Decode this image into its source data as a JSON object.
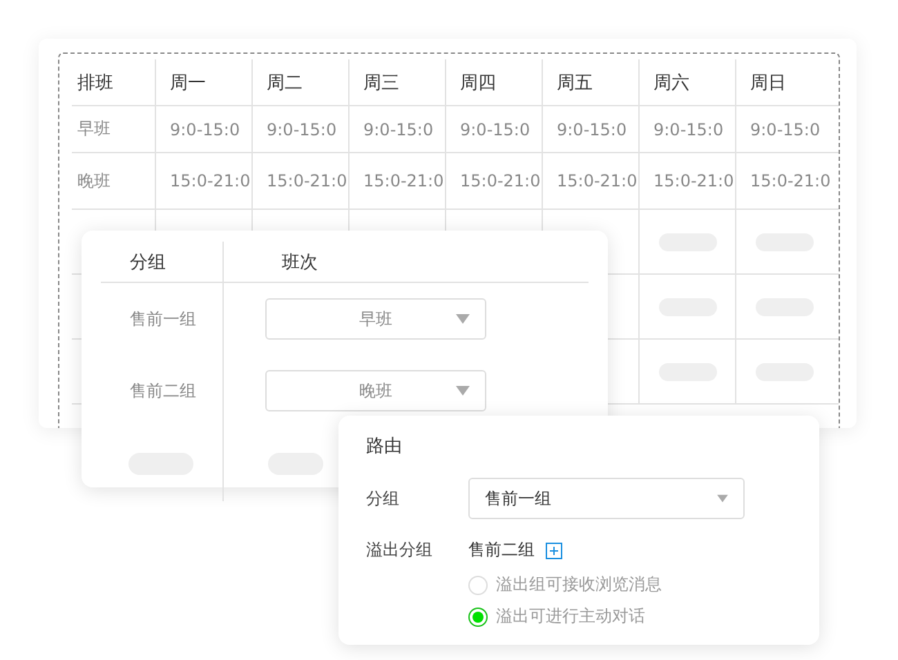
{
  "schedule": {
    "columns": [
      "排班",
      "周一",
      "周二",
      "周三",
      "周四",
      "周五",
      "周六",
      "周日"
    ],
    "rows": [
      {
        "cells": [
          "早班",
          "9:0-15:0",
          "9:0-15:0",
          "9:0-15:0",
          "9:0-15:0",
          "9:0-15:0",
          "9:0-15:0",
          "9:0-15:0"
        ]
      },
      {
        "cells": [
          "晚班",
          "15:0-21:0",
          "15:0-21:0",
          "15:0-21:0",
          "15:0-21:0",
          "15:0-21:0",
          "15:0-21:0",
          "15:0-21:0"
        ]
      }
    ]
  },
  "group_card": {
    "columns": [
      "分组",
      "班次"
    ],
    "rows": [
      {
        "group": "售前一组",
        "shift": "早班"
      },
      {
        "group": "售前二组",
        "shift": "晚班"
      }
    ]
  },
  "routing": {
    "title": "路由",
    "group_label": "分组",
    "group_value": "售前一组",
    "overflow_label": "溢出分组",
    "overflow_value": "售前二组",
    "options": [
      {
        "label": "溢出组可接收浏览消息",
        "selected": false
      },
      {
        "label": "溢出可进行主动对话",
        "selected": true
      }
    ]
  }
}
